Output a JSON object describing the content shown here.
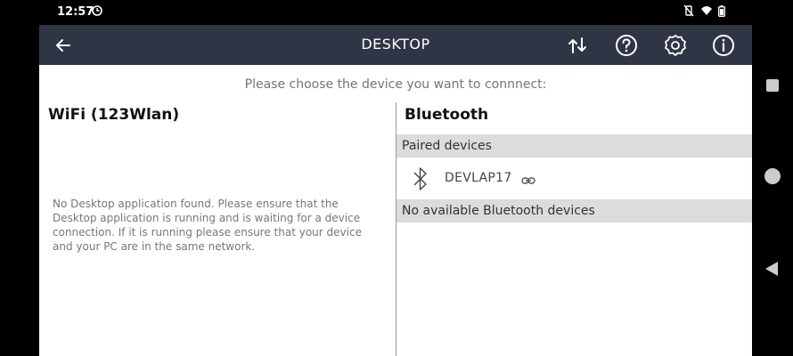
{
  "status_bar": {
    "time": "12:57",
    "icons": [
      "alarm-clock-icon",
      "vibrate-off-icon",
      "wifi-icon",
      "battery-icon"
    ]
  },
  "app_bar": {
    "title": "DESKTOP",
    "back_icon": "arrow-left-icon",
    "actions": [
      "sync-icon",
      "help-icon",
      "settings-icon",
      "info-icon"
    ],
    "background": "#2f3545"
  },
  "content": {
    "prompt": "Please choose the device you want to connnect:",
    "wifi": {
      "title": "WiFi (123Wlan)",
      "message": "No Desktop application found. Please ensure that the Desktop application is running and is waiting for a device connection. If it is running please ensure that your device and your PC are in the same network."
    },
    "bluetooth": {
      "title": "Bluetooth",
      "paired_header": "Paired devices",
      "paired_devices": [
        {
          "name": "DEVLAP17",
          "icon": "bluetooth-icon",
          "status_icon": "link-icon"
        }
      ],
      "available_header": "No available Bluetooth devices"
    }
  },
  "nav_bar": {
    "buttons": [
      "recent-apps",
      "home",
      "back"
    ]
  }
}
